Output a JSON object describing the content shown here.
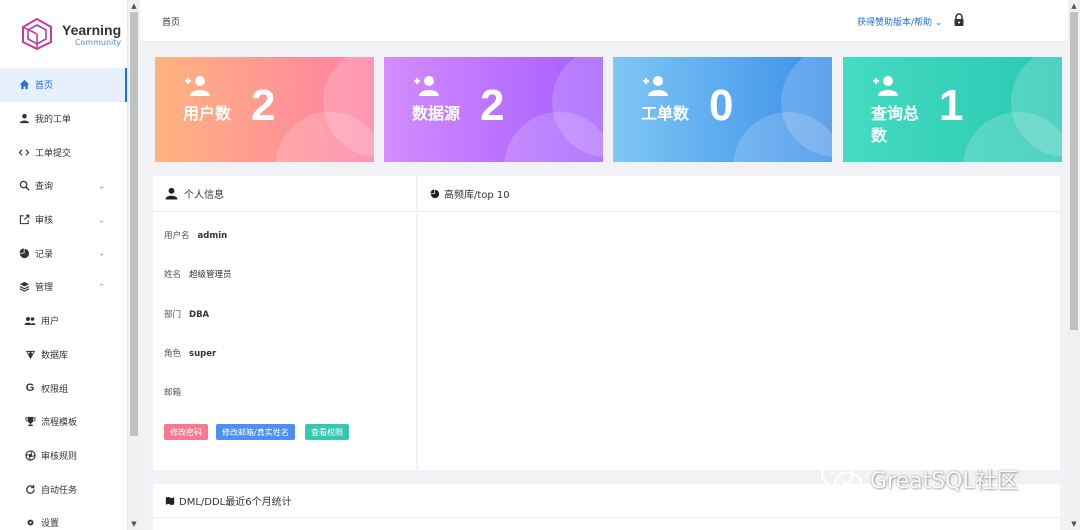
{
  "app": {
    "name": "Yearning",
    "edition": "Community"
  },
  "sidebar": {
    "items": [
      {
        "label": "首页",
        "icon": "home-icon",
        "active": true
      },
      {
        "label": "我的工单",
        "icon": "user-icon"
      },
      {
        "label": "工单提交",
        "icon": "code-icon"
      },
      {
        "label": "查询",
        "icon": "search-icon",
        "expand": "collapsed"
      },
      {
        "label": "审核",
        "icon": "edit-icon",
        "expand": "collapsed"
      },
      {
        "label": "记录",
        "icon": "pie-chart-icon",
        "expand": "collapsed"
      },
      {
        "label": "管理",
        "icon": "layers-icon",
        "expand": "expanded"
      },
      {
        "label": "用户",
        "icon": "users-icon",
        "sub": true
      },
      {
        "label": "数据库",
        "icon": "database-icon",
        "sub": true
      },
      {
        "label": "权限组",
        "icon": "google-icon",
        "sub": true
      },
      {
        "label": "流程模板",
        "icon": "trophy-icon",
        "sub": true
      },
      {
        "label": "审核规则",
        "icon": "aperture-icon",
        "sub": true
      },
      {
        "label": "自动任务",
        "icon": "refresh-icon",
        "sub": true
      },
      {
        "label": "设置",
        "icon": "settings-icon",
        "sub": true
      }
    ]
  },
  "header": {
    "breadcrumb": "首页",
    "help_link": "获得赞助版本/帮助"
  },
  "stats": [
    {
      "label": "用户数",
      "value": "2",
      "color_from": "#ffb37f",
      "color_to": "#ff7fa5"
    },
    {
      "label": "数据源",
      "value": "2",
      "color_from": "#d48cff",
      "color_to": "#a35cff"
    },
    {
      "label": "工单数",
      "value": "0",
      "color_from": "#7fc7f5",
      "color_to": "#3a8ee8"
    },
    {
      "label": "查询总数",
      "value": "1",
      "color_from": "#44dcc1",
      "color_to": "#2ac7b3"
    }
  ],
  "profile": {
    "title": "个人信息",
    "fields": [
      {
        "label": "用户名",
        "value": "admin"
      },
      {
        "label": "姓名",
        "value": "超级管理员"
      },
      {
        "label": "部门",
        "value": "DBA"
      },
      {
        "label": "角色",
        "value": "super"
      },
      {
        "label": "邮箱",
        "value": ""
      }
    ],
    "buttons": [
      {
        "label": "修改密码",
        "color": "#f7798f"
      },
      {
        "label": "修改邮箱/真实姓名",
        "color": "#4d8ef7"
      },
      {
        "label": "查看权限",
        "color": "#34c9b0"
      }
    ]
  },
  "top_db": {
    "title": "高频库/top 10"
  },
  "dml_stats": {
    "title": "DML/DDL最近6个月统计"
  },
  "watermark": {
    "text": "GreatSQL社区"
  }
}
